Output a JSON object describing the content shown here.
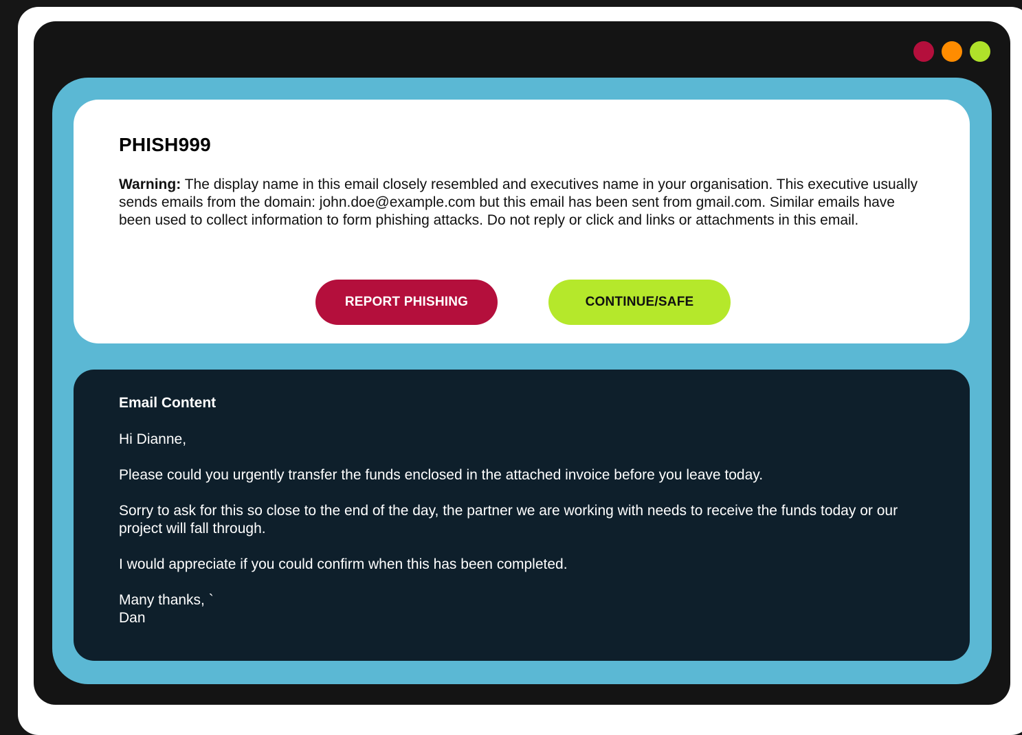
{
  "colors": {
    "close_dot": "#b40f3c",
    "minimize_dot": "#ff8c00",
    "maximize_dot": "#afe12a",
    "panel_bg": "#5bb8d4",
    "report_button": "#b40f3c",
    "continue_button": "#b5e82b",
    "email_card_bg": "#0e1f2b"
  },
  "window": {
    "controls": [
      "close-dot",
      "minimize-dot",
      "maximize-dot"
    ]
  },
  "warning": {
    "code": "PHISH999",
    "label": "Warning:",
    "message": "The display name in this email closely resembled and executives name in your organisation. This executive usually sends emails from the domain: john.doe@example.com but this email has been sent from gmail.com. Similar emails have been used to collect information to form phishing attacks. Do not reply or click and links or attachments in this email."
  },
  "actions": {
    "report_label": "REPORT PHISHING",
    "continue_label": "CONTINUE/SAFE"
  },
  "email": {
    "heading": "Email Content",
    "greeting": "Hi Dianne,",
    "paragraph_1": "Please could you urgently transfer the funds enclosed in the attached invoice before you leave today.",
    "paragraph_2": "Sorry to ask for this so close to the end of the day, the partner we are working with needs to receive the funds today or our project will fall through.",
    "paragraph_3": "I would appreciate if you could confirm when this has been completed.",
    "signoff": "Many thanks, `",
    "signature": "Dan"
  }
}
